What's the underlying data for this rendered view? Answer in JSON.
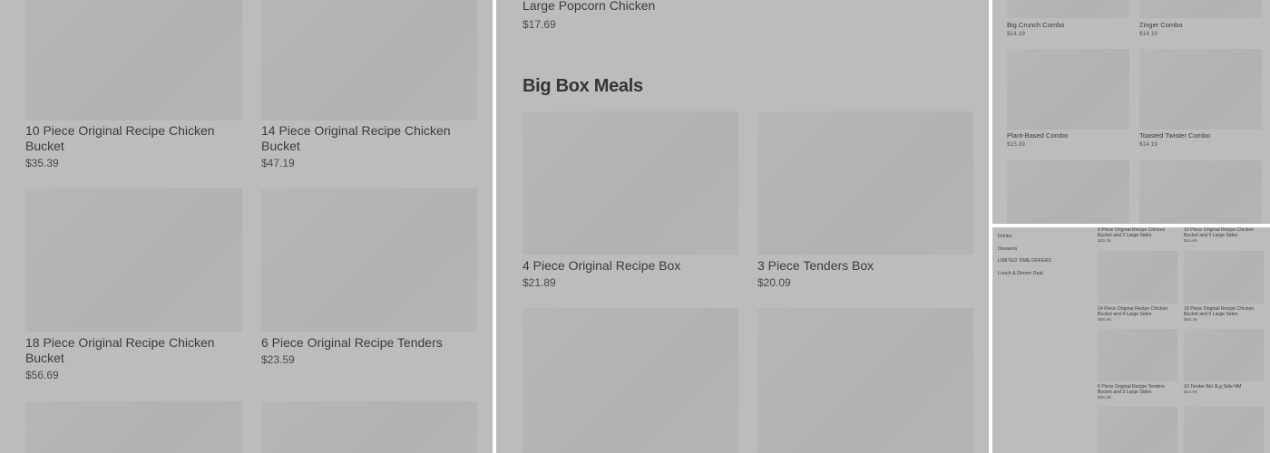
{
  "panel1": {
    "items": [
      {
        "name": "10 Piece Original Recipe Chicken Bucket",
        "price": "$35.39"
      },
      {
        "name": "14 Piece Original Recipe Chicken Bucket",
        "price": "$47.19"
      },
      {
        "name": "18 Piece Original Recipe Chicken Bucket",
        "price": "$56.69"
      },
      {
        "name": "6 Piece Original Recipe Tenders",
        "price": "$23.59"
      }
    ]
  },
  "panel2": {
    "top_item": {
      "name": "Large Popcorn Chicken",
      "price": "$17.69"
    },
    "section_title": "Big Box Meals",
    "items": [
      {
        "name": "4 Piece Original Recipe Box",
        "price": "$21.89"
      },
      {
        "name": "3 Piece Tenders Box",
        "price": "$20.09"
      }
    ]
  },
  "panel3": {
    "items": [
      {
        "name": "Big Crunch Combo",
        "price": "$14.19"
      },
      {
        "name": "Zinger Combo",
        "price": "$14.19"
      },
      {
        "name": "Plant-Based Combo",
        "price": "$15.39"
      },
      {
        "name": "Toasted Twister Combo",
        "price": "$14.19"
      }
    ]
  },
  "panel4": {
    "sidebar": [
      "Drinks",
      "Desserts",
      "LIMITED TIME OFFERS",
      "Lunch & Dinner Deal"
    ],
    "items": [
      {
        "name": "6 Piece Original Recipe Chicken Bucket and 2 Large Sides",
        "price": "$35.39"
      },
      {
        "name": "10 Piece Original Recipe Chicken Bucket and 3 Large Sides",
        "price": "$44.69"
      },
      {
        "name": "14 Piece Original Recipe Chicken Bucket and 4 Large Sides",
        "price": "$56.69"
      },
      {
        "name": "18 Piece Original Recipe Chicken Bucket and 5 Large Sides",
        "price": "$68.49"
      },
      {
        "name": "6 Piece Original Recipe Tenders Bucket and 2 Large Sides",
        "price": "$35.39"
      },
      {
        "name": "10 Tender Bkt 3Lg Side NM",
        "price": "$44.69"
      }
    ]
  }
}
